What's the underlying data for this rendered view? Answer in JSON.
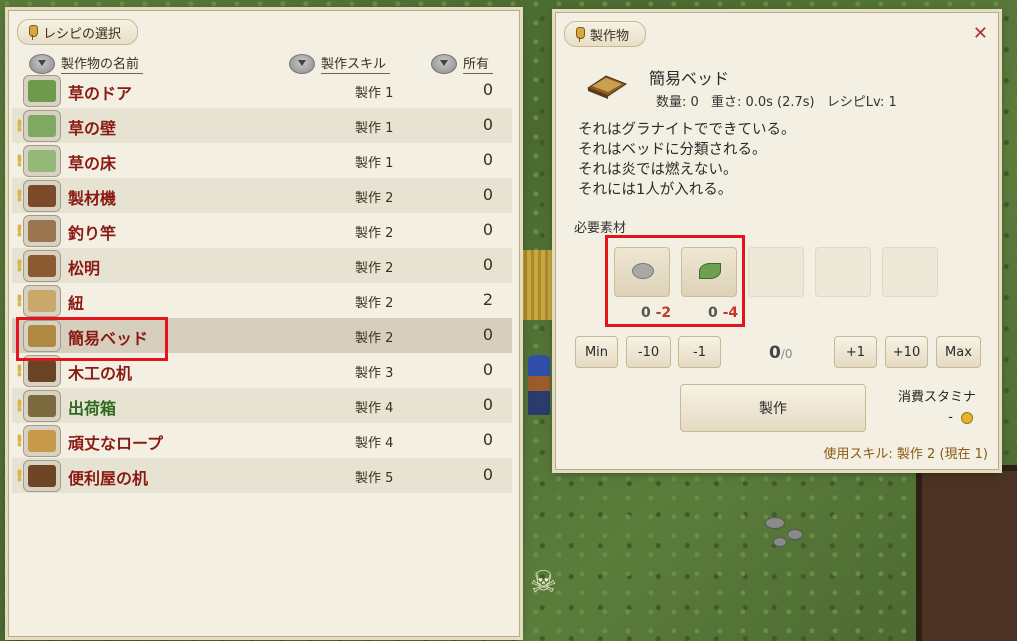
{
  "recipe_panel": {
    "title": "レシピの選択",
    "headers": {
      "name": "製作物の名前",
      "skill": "製作スキル",
      "owned": "所有"
    },
    "items": [
      {
        "name": "草のドア",
        "skill": "製作 1",
        "owned": "0",
        "new": false,
        "color": "#6f9a4e"
      },
      {
        "name": "草の壁",
        "skill": "製作 1",
        "owned": "0",
        "new": true,
        "color": "#7fa860"
      },
      {
        "name": "草の床",
        "skill": "製作 1",
        "owned": "0",
        "new": true,
        "color": "#93b878"
      },
      {
        "name": "製材機",
        "skill": "製作 2",
        "owned": "0",
        "new": true,
        "color": "#7a4a2a"
      },
      {
        "name": "釣り竿",
        "skill": "製作 2",
        "owned": "0",
        "new": true,
        "color": "#9a7650"
      },
      {
        "name": "松明",
        "skill": "製作 2",
        "owned": "0",
        "new": true,
        "color": "#8a5a30"
      },
      {
        "name": "紐",
        "skill": "製作 2",
        "owned": "2",
        "new": true,
        "color": "#c9a86a"
      },
      {
        "name": "簡易ベッド",
        "skill": "製作 2",
        "owned": "0",
        "new": false,
        "color": "#b08a40"
      },
      {
        "name": "木工の机",
        "skill": "製作 3",
        "owned": "0",
        "new": true,
        "color": "#6a4224"
      },
      {
        "name": "出荷箱",
        "skill": "製作 4",
        "owned": "0",
        "new": true,
        "color": "#7b6a3e"
      },
      {
        "name": "頑丈なロープ",
        "skill": "製作 4",
        "owned": "0",
        "new": true,
        "color": "#c79a4a"
      },
      {
        "name": "便利屋の机",
        "skill": "製作 5",
        "owned": "0",
        "new": true,
        "color": "#6e4626"
      }
    ]
  },
  "craft_panel": {
    "title": "製作物",
    "product_name": "簡易ベッド",
    "stats": {
      "qty": "数量: 0",
      "weight": "重さ: 0.0s (2.7s)",
      "level": "レシピLv: 1"
    },
    "description": [
      "それはグラナイトでできている。",
      "それはベッドに分類される。",
      "それは炎では燃えない。",
      "それには1人が入れる。"
    ],
    "materials_label": "必要素材",
    "materials": [
      {
        "have": "0",
        "need": "-2",
        "color": "#a9a9a4"
      },
      {
        "have": "0",
        "need": "-4",
        "color": "#6fa050"
      }
    ],
    "buttons": {
      "min": "Min",
      "minus10": "-10",
      "minus1": "-1",
      "plus1": "+1",
      "plus10": "+10",
      "max": "Max",
      "craft": "製作"
    },
    "quantity": {
      "current": "0",
      "max": "/0"
    },
    "stamina_label": "消費スタミナ",
    "stamina_value": "-",
    "skill_used": "使用スキル: 製作 2 (現在 1)"
  }
}
